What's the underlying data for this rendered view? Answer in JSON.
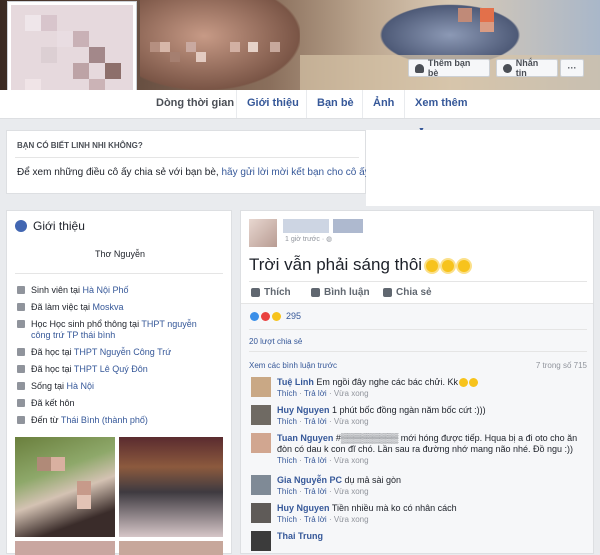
{
  "cover": {
    "add_friend": "Thêm bạn bè",
    "message": "Nhắn tin",
    "more": "···"
  },
  "nav": {
    "items": [
      "Dòng thời gian",
      "Giới thiệu",
      "Bạn bè",
      "Ảnh",
      "Xem thêm"
    ]
  },
  "know": {
    "title": "BẠN CÓ BIẾT LINH NHI KHÔNG?",
    "text_prefix": "Để xem những điều cô ấy chia sẻ với bạn bè, ",
    "text_link": "hãy gửi lời mời kết bạn cho cô ấy."
  },
  "intro": {
    "title": "Giới thiệu",
    "name": "Thơ Nguyễn",
    "rows": [
      {
        "pre": "Sinh viên tại ",
        "link": "Hà Nội Phố",
        "icon": "briefcase-icon"
      },
      {
        "pre": "Đã làm việc tại ",
        "link": "Moskva",
        "icon": "briefcase-icon"
      },
      {
        "pre": "Học Học sinh phổ thông tại ",
        "link": "THPT nguyễn công trứ TP thái bình",
        "icon": "graduation-cap-icon"
      },
      {
        "pre": "Đã học tại ",
        "link": "THPT Nguyễn Công Trứ",
        "icon": "graduation-cap-icon"
      },
      {
        "pre": "Đã học tại ",
        "link": "THPT Lê Quý Đôn",
        "icon": "graduation-cap-icon"
      },
      {
        "pre": "Sống tại ",
        "link": "Hà Nội",
        "icon": "home-icon"
      },
      {
        "pre": "Đã kết hôn",
        "link": "",
        "icon": "heart-icon"
      },
      {
        "pre": "Đến từ ",
        "link": "Thái Bình (thành phố)",
        "icon": "location-pin-icon"
      }
    ]
  },
  "post": {
    "time": "1 giờ trước ·",
    "text": "Trời vẫn phải sáng thôi",
    "actions": [
      "Thích",
      "Bình luận",
      "Chia sẻ"
    ],
    "reaction_count": "295",
    "shares": "20 lượt chia sẻ",
    "view_more": "Xem các bình luận trước",
    "count": "7 trong số 715",
    "comments": [
      {
        "name": "Tuệ Linh",
        "text": "Em ngồi đây nghe các bác chửi. Kk"
      },
      {
        "name": "Huy Nguyen",
        "text": "1 phút bốc đồng ngàn năm bốc cứt :)))"
      },
      {
        "name": "Tuan Nguyen",
        "text": "#▒▒▒▒▒▒▒▒▒ mới hóng được tiếp. Hqua bị a đi oto cho ăn đòn có dau k con đĩ chó. Lần sau ra đường nhớ mang não nhé. Đồ ngu :))"
      },
      {
        "name": "Gia Nguyễn PC",
        "text": "dụ mả sài gòn"
      },
      {
        "name": "Huy Nguyen",
        "text": "Tiền nhiều mà ko có nhân cách"
      },
      {
        "name": "Thai Trung",
        "text": ""
      }
    ],
    "like_label": "Thích",
    "reply_label": "Trả lời",
    "time_label": "Vừa xong"
  }
}
